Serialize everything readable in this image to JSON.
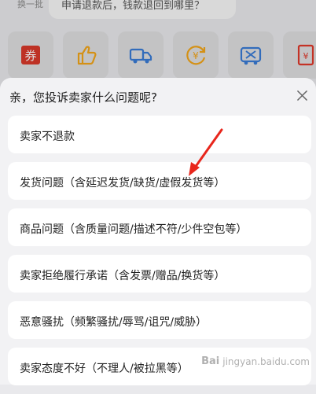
{
  "background": {
    "swap_label": "换一批",
    "bubble_text": "申请退款后，钱款退回到哪里？",
    "tiles": [
      {
        "icon": "coupon-icon",
        "color": "#d93a2b"
      },
      {
        "icon": "thumbs-up-icon",
        "color": "#f2a51a"
      },
      {
        "icon": "truck-icon",
        "color": "#3a7bd5"
      },
      {
        "icon": "yen-refund-icon",
        "color": "#f2a51a"
      },
      {
        "icon": "delivery-box-icon",
        "color": "#3a7bd5"
      },
      {
        "icon": "invoice-icon",
        "color": "#e0392b"
      }
    ]
  },
  "sheet": {
    "title": "亲，您投诉卖家什么问题呢?",
    "close_icon": "close-icon",
    "options": [
      "卖家不退款",
      "发货问题（含延迟发货/缺货/虚假发货等）",
      "商品问题（含质量问题/描述不符/少件空包等）",
      "卖家拒绝履行承诺（含发票/赠品/换货等）",
      "恶意骚扰（频繁骚扰/辱骂/诅咒/威胁）",
      "卖家态度不好（不理人/被拉黑等）"
    ]
  },
  "annotation": {
    "arrow_color": "#e8261c"
  },
  "watermark": {
    "logo_text": "Bai",
    "site_text": "jingyan.baidu.com"
  }
}
